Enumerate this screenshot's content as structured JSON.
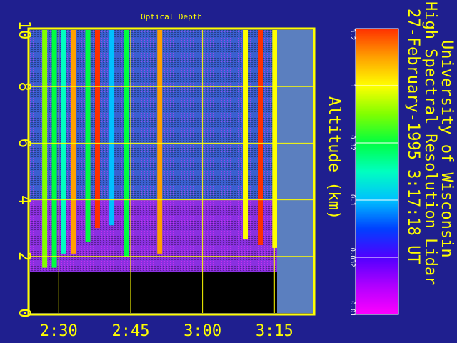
{
  "title": "Optical Depth",
  "header_lines": [
    "University of Wisconsin",
    "High Spectral Resolution Lidar",
    "27-February-1995  3:17:18 UT"
  ],
  "colors": {
    "background": "#1f1f8f",
    "axis": "#ffff00",
    "masked_ground": "#000000",
    "no_data": "#5b7fbf"
  },
  "chart_data": {
    "type": "heatmap",
    "title": "Optical Depth",
    "xlabel": "",
    "ylabel": "Altitude (km)",
    "x_ticks": [
      "2:30",
      "2:45",
      "3:00",
      "3:15"
    ],
    "y_ticks": [
      0,
      2,
      4,
      6,
      8,
      10
    ],
    "ylim": [
      0,
      10
    ],
    "grid": true,
    "colorbar": {
      "tick_labels": [
        "0.01",
        "0.032",
        "0.1",
        "0.32",
        "1",
        "3.2"
      ],
      "scale": "log",
      "range": [
        0.01,
        3.2
      ],
      "placement": "right"
    },
    "ground_mask_top_km": 1.5,
    "no_data_after": "3:17",
    "cloud_columns": [
      {
        "time": "2:27",
        "base_km": 1.6,
        "value": 0.5
      },
      {
        "time": "2:29",
        "base_km": 1.6,
        "value": 0.3
      },
      {
        "time": "2:31",
        "base_km": 2.1,
        "value": 0.2
      },
      {
        "time": "2:33",
        "base_km": 2.1,
        "value": 2.0
      },
      {
        "time": "2:36",
        "base_km": 2.5,
        "value": 0.4
      },
      {
        "time": "2:38",
        "base_km": 3.0,
        "value": 2.5
      },
      {
        "time": "2:41",
        "base_km": 3.1,
        "value": 0.1
      },
      {
        "time": "2:44",
        "base_km": 2.0,
        "value": 0.3
      },
      {
        "time": "2:51",
        "base_km": 2.1,
        "value": 2.2
      },
      {
        "time": "3:09",
        "base_km": 2.6,
        "value": 1.0
      },
      {
        "time": "3:12",
        "base_km": 2.4,
        "value": 2.8
      },
      {
        "time": "3:15",
        "base_km": 2.3,
        "value": 1.0
      }
    ]
  }
}
